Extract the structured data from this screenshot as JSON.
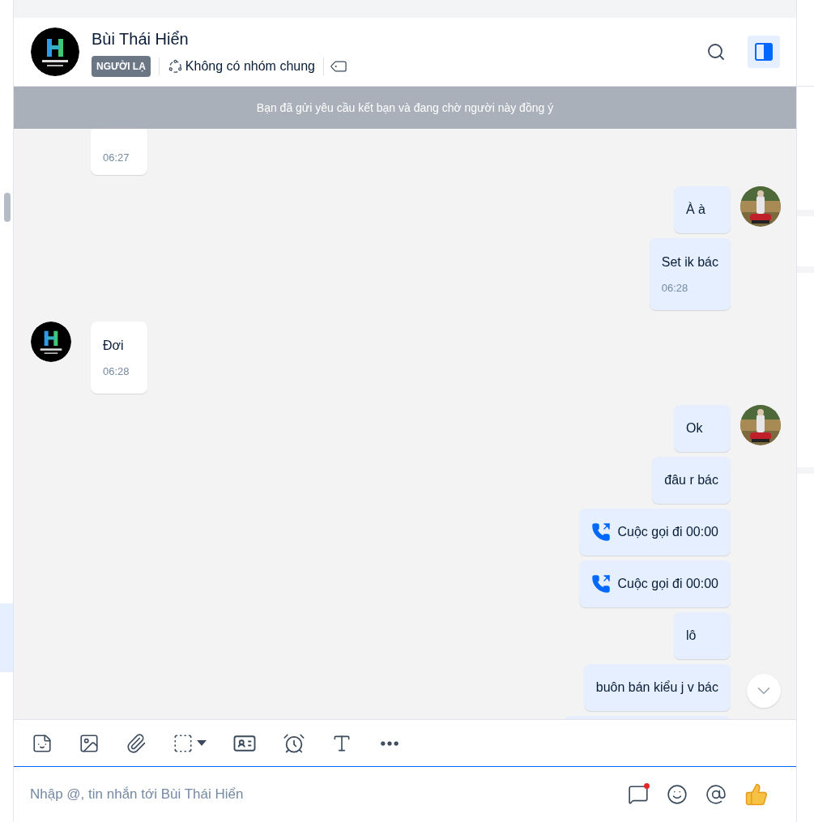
{
  "header": {
    "name": "Bùi Thái Hiển",
    "tag": "NGƯỜI LẠ",
    "groups": "Không có nhóm chung",
    "info_panel_open": true
  },
  "banner": "Bạn đã gửi yêu cầu kết bạn và đang chờ người này đồng ý",
  "messages": [
    {
      "outgoing": false,
      "kind": "text",
      "time": "06:27",
      "avatar": false
    },
    {
      "outgoing": true,
      "kind": "text",
      "text": "À à",
      "avatar": true
    },
    {
      "outgoing": true,
      "kind": "text",
      "text": "Set ik bác",
      "time": "06:28",
      "avatar": false
    },
    {
      "outgoing": false,
      "kind": "text",
      "text": "Đơi",
      "time": "06:28",
      "avatar": true
    },
    {
      "outgoing": true,
      "kind": "text",
      "text": "Ok",
      "avatar": true
    },
    {
      "outgoing": true,
      "kind": "text",
      "text": "đâu r bác",
      "avatar": false
    },
    {
      "outgoing": true,
      "kind": "call",
      "text": "Cuộc gọi đi 00:00",
      "avatar": false
    },
    {
      "outgoing": true,
      "kind": "call",
      "text": "Cuộc gọi đi 00:00",
      "avatar": false
    },
    {
      "outgoing": true,
      "kind": "text",
      "text": "lô",
      "avatar": false
    },
    {
      "outgoing": true,
      "kind": "text",
      "text": "buôn bán kiểu j v bác",
      "avatar": false
    },
    {
      "outgoing": true,
      "kind": "text",
      "avatar": false
    }
  ],
  "composer": {
    "placeholder": "Nhập @, tin nhắn tới Bùi Thái Hiển",
    "focused": true,
    "quick_message_unread": true
  }
}
